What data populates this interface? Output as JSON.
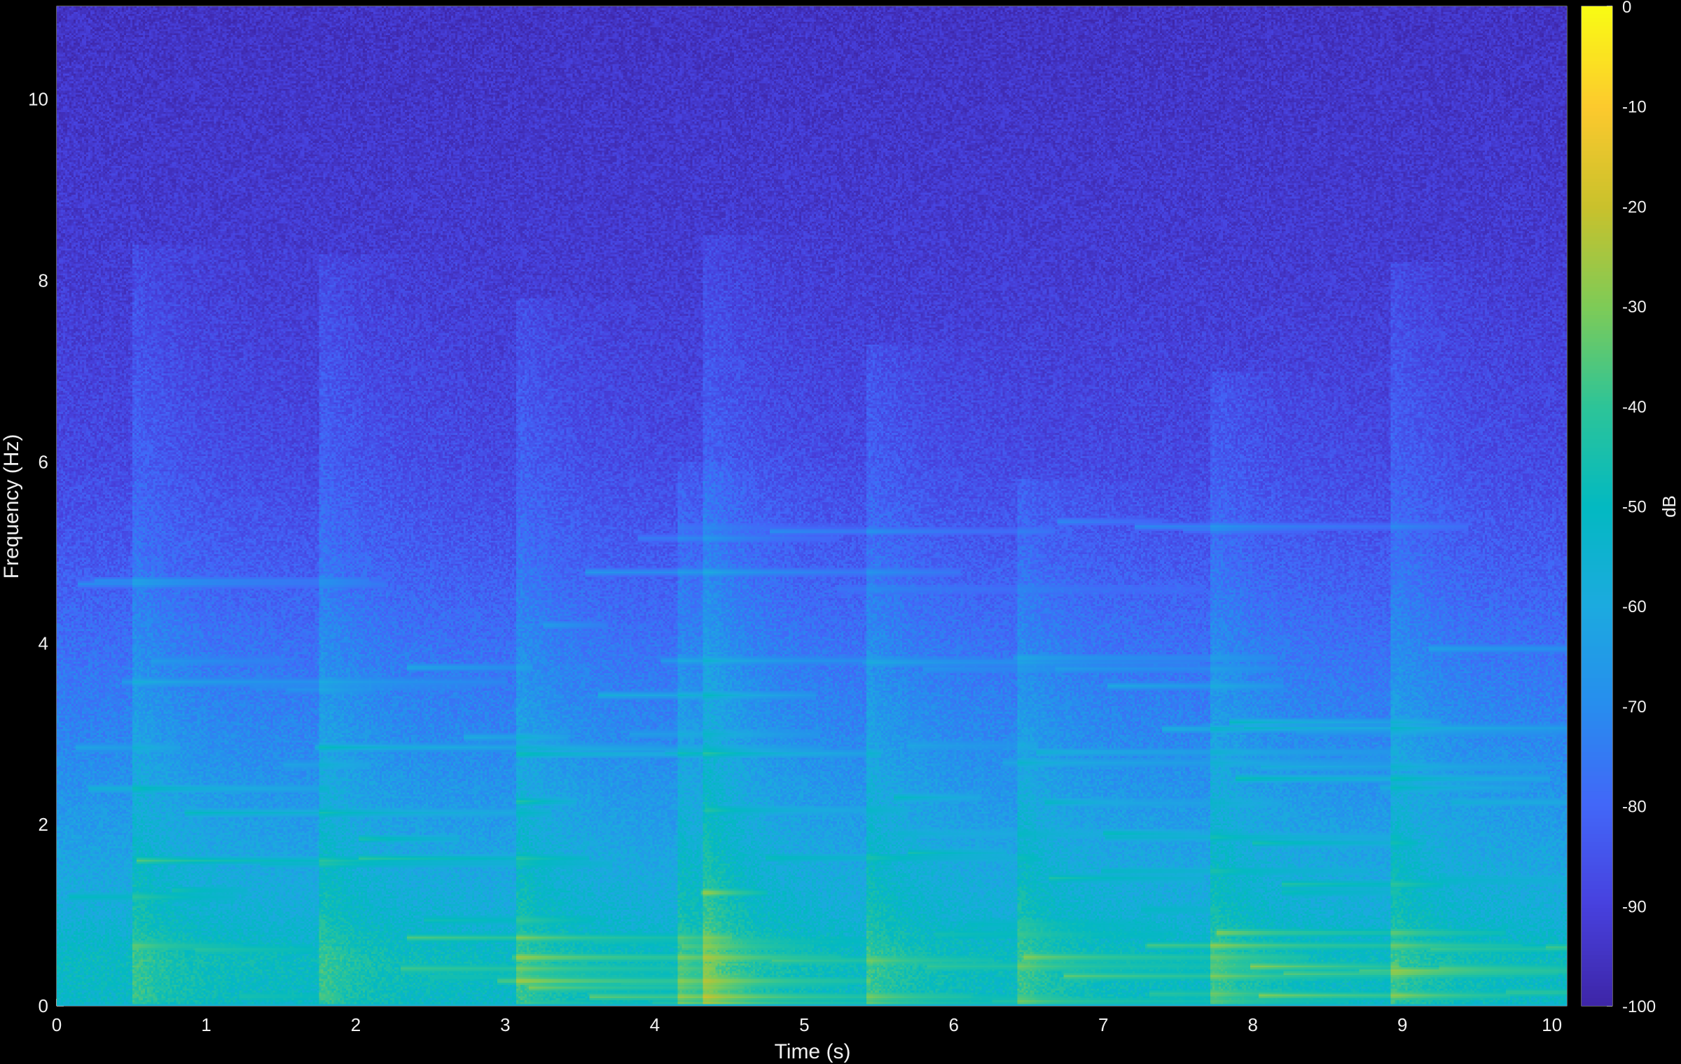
{
  "chart_data": {
    "type": "heatmap",
    "subtype": "spectrogram",
    "title": "",
    "xlabel": "Time (s)",
    "ylabel": "Frequency (Hz)",
    "colorbar_label": "dB",
    "xlim": [
      0,
      10.1
    ],
    "ylim": [
      0,
      11.025
    ],
    "clim": [
      -100,
      0
    ],
    "colormap": "parula",
    "background": "#000000",
    "x_ticks": [
      0,
      1,
      2,
      3,
      4,
      5,
      6,
      7,
      8,
      9,
      10
    ],
    "x_tick_labels": [
      "0",
      "1",
      "2",
      "3",
      "4",
      "5",
      "6",
      "7",
      "8",
      "9",
      "10"
    ],
    "y_ticks": [
      0,
      2,
      4,
      6,
      8,
      10
    ],
    "y_tick_labels": [
      "0",
      "2",
      "4",
      "6",
      "8",
      "10"
    ],
    "colorbar_ticks": [
      0,
      -10,
      -20,
      -30,
      -40,
      -50,
      -60,
      -70,
      -80,
      -90,
      -100
    ],
    "colorbar_tick_labels": [
      "0",
      "-10",
      "-20",
      "-30",
      "-40",
      "-50",
      "-60",
      "-70",
      "-80",
      "-90",
      "-100"
    ],
    "noise_floor_db": -95,
    "broadband_onsets": [
      {
        "time": 0.53,
        "top_freq": 8.4
      },
      {
        "time": 1.78,
        "top_freq": 8.3
      },
      {
        "time": 3.1,
        "top_freq": 7.8
      },
      {
        "time": 4.18,
        "top_freq": 6.0
      },
      {
        "time": 4.35,
        "top_freq": 8.5
      },
      {
        "time": 5.45,
        "top_freq": 7.3
      },
      {
        "time": 6.45,
        "top_freq": 5.8
      },
      {
        "time": 7.75,
        "top_freq": 7.0
      },
      {
        "time": 8.95,
        "top_freq": 8.2
      }
    ],
    "level_profile": [
      {
        "freq": 0.0,
        "db": -52
      },
      {
        "freq": 0.5,
        "db": -50
      },
      {
        "freq": 1.0,
        "db": -57
      },
      {
        "freq": 2.0,
        "db": -65
      },
      {
        "freq": 3.0,
        "db": -72
      },
      {
        "freq": 4.0,
        "db": -78
      },
      {
        "freq": 5.0,
        "db": -84
      },
      {
        "freq": 6.0,
        "db": -88
      },
      {
        "freq": 8.0,
        "db": -92
      },
      {
        "freq": 11.0,
        "db": -95
      }
    ]
  }
}
